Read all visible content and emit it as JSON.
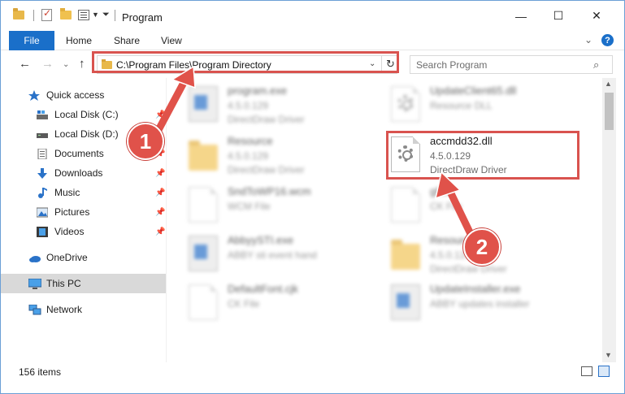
{
  "window": {
    "title": "Program",
    "controls": {
      "minimize": "—",
      "maximize": "☐",
      "close": "✕"
    }
  },
  "ribbon": {
    "tabs": [
      "File",
      "Home",
      "Share",
      "View"
    ],
    "help": "?"
  },
  "address": {
    "path": "C:\\Program Files\\Program Directory",
    "search_placeholder": "Search Program"
  },
  "sidebar": {
    "quick_access": "Quick access",
    "items": [
      {
        "label": "Local Disk (C:)",
        "icon": "drive-icon",
        "pinned": true
      },
      {
        "label": "Local Disk (D:)",
        "icon": "drive-icon",
        "pinned": false
      },
      {
        "label": "Documents",
        "icon": "documents-icon",
        "pinned": true
      },
      {
        "label": "Downloads",
        "icon": "downloads-icon",
        "pinned": true
      },
      {
        "label": "Music",
        "icon": "music-icon",
        "pinned": true
      },
      {
        "label": "Pictures",
        "icon": "pictures-icon",
        "pinned": true
      },
      {
        "label": "Videos",
        "icon": "videos-icon",
        "pinned": true
      }
    ],
    "onedrive": "OneDrive",
    "this_pc": "This PC",
    "network": "Network"
  },
  "files": [
    {
      "name": "program.exe",
      "version": "4.5.0.129",
      "type": "DirectDraw Driver",
      "icon": "exe-icon"
    },
    {
      "name": "UpdateClient65.dll",
      "version": "Resource DLL",
      "type": "",
      "icon": "dll-gear-icon"
    },
    {
      "name": "Resource",
      "version": "4.5.0.129",
      "type": "DirectDraw Driver",
      "icon": "folder-icon"
    },
    {
      "name": "accmdd32.dll",
      "version": "4.5.0.129",
      "type": "DirectDraw Driver",
      "icon": "dll-gear-icon"
    },
    {
      "name": "SndToWP16.wcm",
      "version": "WCM File",
      "type": "",
      "icon": "document-icon"
    },
    {
      "name": "glide",
      "version": "CK File",
      "type": "",
      "icon": "document-icon"
    },
    {
      "name": "AbbyySTI.exe",
      "version": "ABBY sti event hand",
      "type": "",
      "icon": "exe-icon"
    },
    {
      "name": "Resource",
      "version": "4.5.0.129",
      "type": "DirectDraw Driver",
      "icon": "folder-icon"
    },
    {
      "name": "DefaultFont.cjk",
      "version": "CK File",
      "type": "",
      "icon": "document-icon"
    },
    {
      "name": "UpdateInstaller.exe",
      "version": "ABBY updates installer",
      "type": "",
      "icon": "exe-icon"
    }
  ],
  "status": {
    "count": "156 items"
  },
  "callouts": [
    "1",
    "2"
  ],
  "colors": {
    "accent": "#1a6fc9",
    "highlight": "#d9534f",
    "selection": "#d9d9d9"
  }
}
